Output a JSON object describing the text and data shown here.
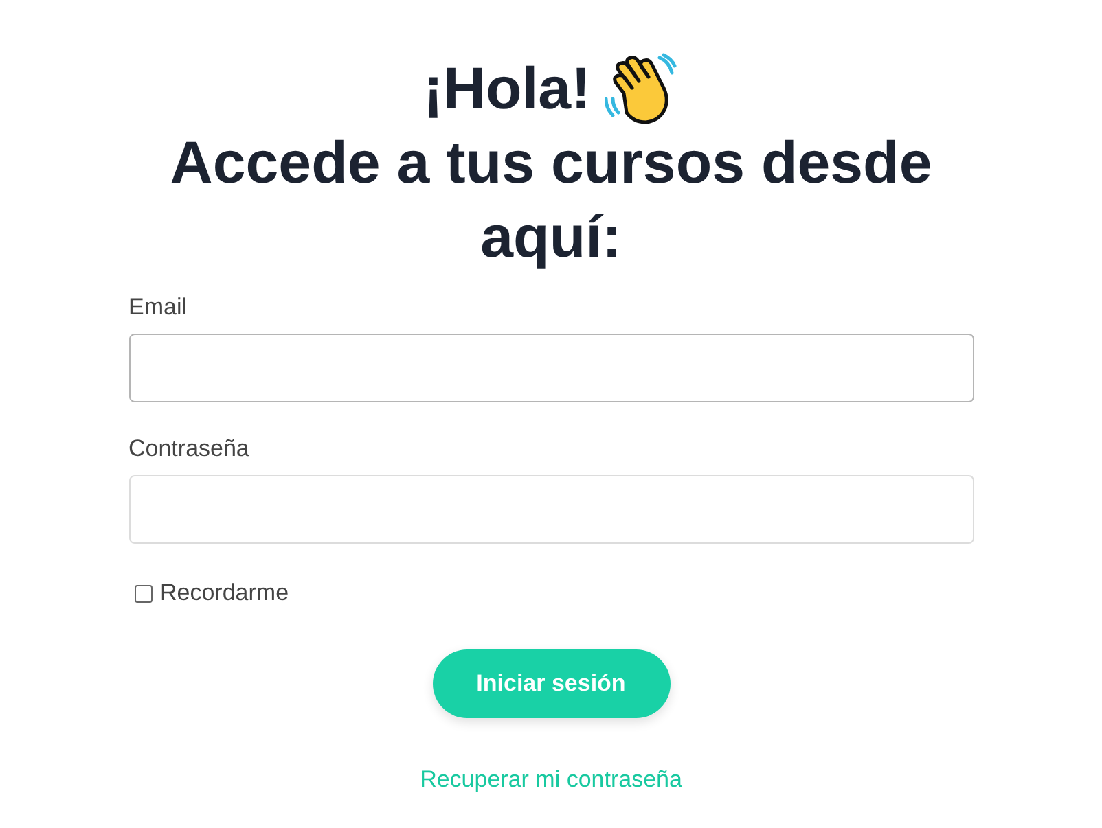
{
  "heading": {
    "greeting": "¡Hola!",
    "subtitle": "Accede a tus cursos desde aquí:"
  },
  "fields": [
    {
      "label": "Email"
    },
    {
      "label": "Contraseña"
    }
  ],
  "remember": {
    "label": "Recordarme",
    "checked": false
  },
  "submit": {
    "label": "Iniciar sesión"
  },
  "recover_link": {
    "label": "Recuperar mi contraseña"
  }
}
